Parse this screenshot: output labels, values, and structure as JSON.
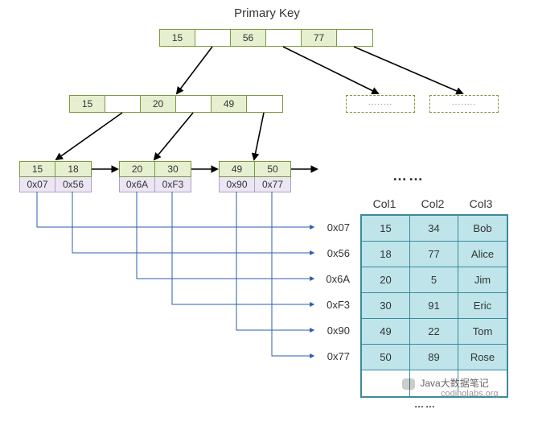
{
  "title": "Primary Key",
  "root_node": {
    "keys": [
      "15",
      "56",
      "77"
    ]
  },
  "internal_node": {
    "keys": [
      "15",
      "20",
      "49"
    ]
  },
  "leaf_nodes": [
    {
      "keys": [
        "15",
        "18"
      ],
      "addrs": [
        "0x07",
        "0x56"
      ]
    },
    {
      "keys": [
        "20",
        "30"
      ],
      "addrs": [
        "0x6A",
        "0xF3"
      ]
    },
    {
      "keys": [
        "49",
        "50"
      ],
      "addrs": [
        "0x90",
        "0x77"
      ]
    }
  ],
  "ellipsis": "……",
  "pointer_labels": [
    "0x07",
    "0x56",
    "0x6A",
    "0xF3",
    "0x90",
    "0x77"
  ],
  "table_headers": [
    "Col1",
    "Col2",
    "Col3"
  ],
  "table_rows": [
    [
      "15",
      "34",
      "Bob"
    ],
    [
      "18",
      "77",
      "Alice"
    ],
    [
      "20",
      "5",
      "Jim"
    ],
    [
      "30",
      "91",
      "Eric"
    ],
    [
      "49",
      "22",
      "Tom"
    ],
    [
      "50",
      "89",
      "Rose"
    ]
  ],
  "watermark": {
    "line1": "Java大数据笔记",
    "line2": "codinglabs.org"
  },
  "phantom_dots": "........"
}
